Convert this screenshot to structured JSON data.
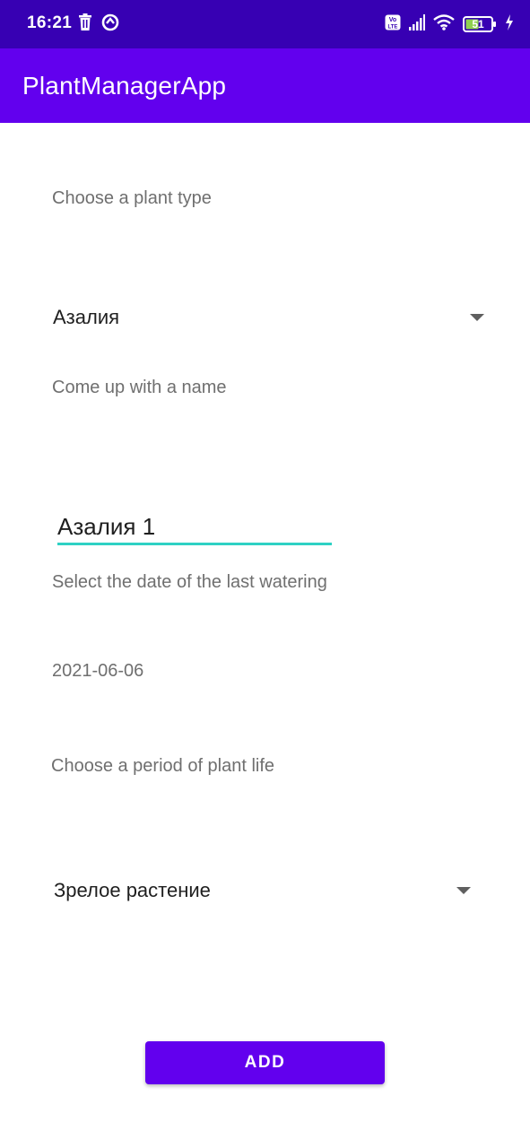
{
  "status_bar": {
    "time": "16:21",
    "battery_level": "51",
    "network_badge": "Vo LTE",
    "left_icons": [
      "trash-icon",
      "circle-sync-icon"
    ],
    "right_icons": [
      "volte-icon",
      "signal-icon",
      "wifi-icon",
      "battery-icon",
      "charging-icon"
    ]
  },
  "app_bar": {
    "title": "PlantManagerApp"
  },
  "form": {
    "plant_type_label": "Choose a plant type",
    "plant_type_value": "Азалия",
    "name_label": "Come up with a name",
    "name_value": "Азалия 1",
    "watering_label": "Select the date of the last watering",
    "watering_date": "2021-06-06",
    "life_period_label": "Choose a period of plant life",
    "life_period_value": "Зрелое растение",
    "add_button_label": "ADD"
  },
  "colors": {
    "status_bar": "#3700b3",
    "primary": "#6200ee",
    "accent_underline": "#2ed1c4",
    "label_text": "#6f6f6f"
  }
}
